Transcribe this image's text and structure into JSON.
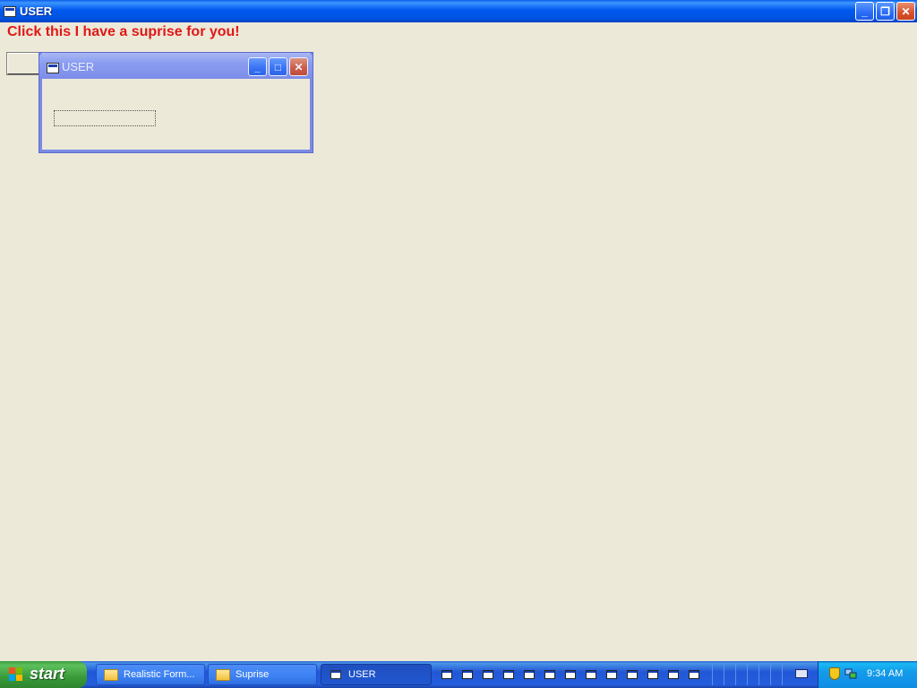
{
  "main_window": {
    "title": "USER",
    "controls": {
      "minimize": "_",
      "restore": "❐",
      "close": "✕"
    }
  },
  "form": {
    "label": "Click this I have a suprise for you!"
  },
  "dialog": {
    "title": "USER",
    "controls": {
      "minimize": "_",
      "maximize": "□",
      "close": "✕"
    }
  },
  "taskbar": {
    "start_label": "start",
    "buttons": [
      {
        "label": "Realistic Form...",
        "icon": "folder-icon"
      },
      {
        "label": "Suprise",
        "icon": "folder-icon"
      },
      {
        "label": "USER",
        "icon": "app-window-icon",
        "active": true
      }
    ],
    "quick_launch_count": 13,
    "tray": {
      "clock": "9:34 AM"
    }
  },
  "colors": {
    "desktop": "#ECE9D8",
    "title_blue": "#0054E3",
    "label_red": "#E01818",
    "dialog_inactive": "#7B8DE8"
  }
}
